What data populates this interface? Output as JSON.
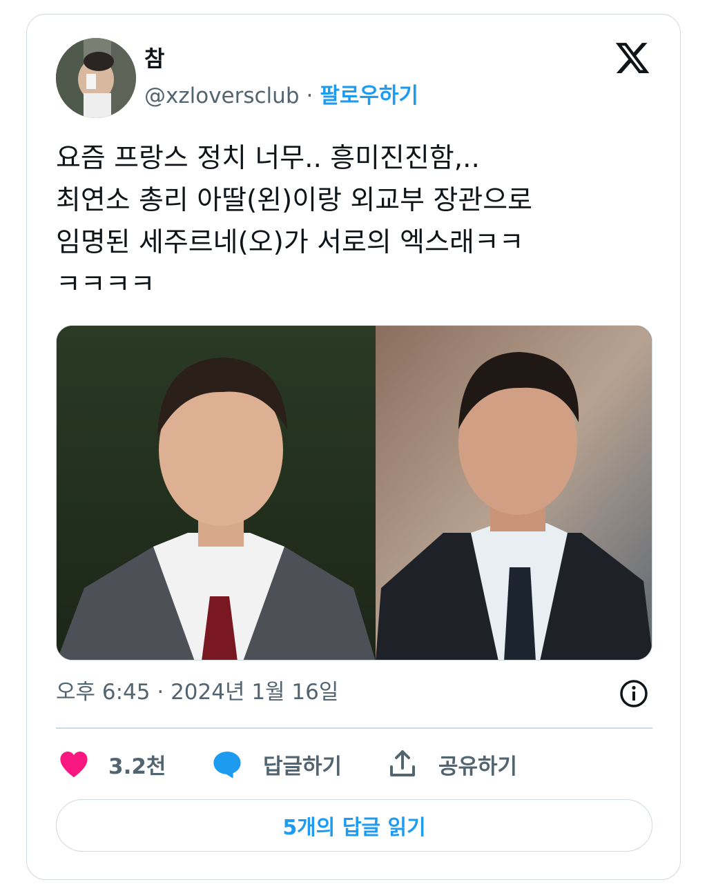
{
  "author": {
    "name": "참",
    "handle": "@xzloversclub",
    "separator": "·",
    "follow_label": "팔로우하기"
  },
  "logo": {
    "icon": "x-logo-icon"
  },
  "tweet": {
    "text": "요즘 프랑스 정치 너무.. 흥미진진함,..\n최연소 총리 아딸(왼)이랑 외교부 장관으로\n임명된 세주르네(오)가 서로의 엑스래ㅋㅋ\nㅋㅋㅋㅋ"
  },
  "meta": {
    "timestamp": "오후 6:45 · 2024년 1월 16일",
    "info_icon": "info-icon"
  },
  "actions": {
    "like_count": "3.2천",
    "reply_label": "답글하기",
    "share_label": "공유하기"
  },
  "replies_button": "5개의 답글 읽기",
  "colors": {
    "accent": "#1d9bf0",
    "like": "#f91880",
    "muted": "#536471",
    "border": "#cfd9de"
  }
}
